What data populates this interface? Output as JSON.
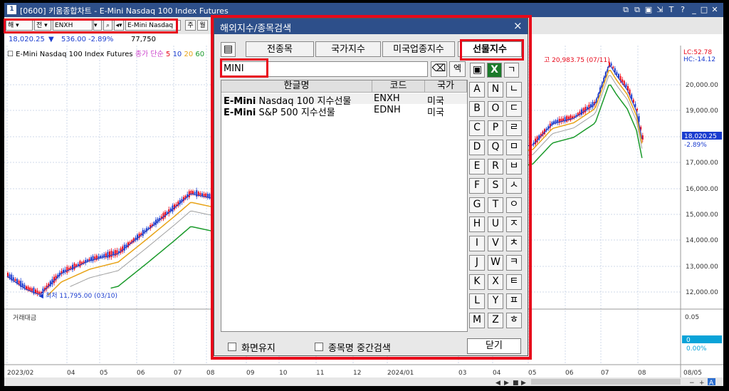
{
  "window": {
    "title": "[0600] 키움종합차트 - E-Mini Nasdaq 100 Index Futures",
    "app_icon": "1",
    "title_icons": [
      "restore-icon",
      "copy-icon",
      "window-icon",
      "pin-icon",
      "text-icon",
      "help-icon",
      "minimize-icon",
      "maximize-icon",
      "close-icon"
    ],
    "title_glyphs": [
      "⧉",
      "⧉",
      "▣",
      "⇲",
      "T",
      "?",
      "_",
      "□",
      "✕"
    ]
  },
  "toolbar": {
    "btn1": "해",
    "btn2": "전",
    "code": "ENXH",
    "search_glyph": "🔍",
    "name": "E-Mini Nasdaq",
    "btn_ju": "주",
    "btn_wol": "월"
  },
  "infobar": {
    "price": "18,020.25",
    "down_arrow": "▼",
    "change": "536.00",
    "pct": "-2.89%",
    "volume": "77,750"
  },
  "legend": {
    "name": "E-Mini Nasdaq 100 Index Futures",
    "ma_label": "종가 단순",
    "ma_values": [
      "5",
      "10",
      "20",
      "60"
    ]
  },
  "chart": {
    "high_label": "고 20,983.75 (07/11)",
    "low_label": "최저 11,795.00 (03/10)",
    "price_axis": [
      "20,000.00",
      "19,000.00",
      "18,000.00",
      "17,000.00",
      "16,000.00",
      "15,000.00",
      "14,000.00",
      "13,000.00",
      "12,000.00"
    ],
    "right_top_1": "LC:52.78",
    "right_top_2": "HC:-14.12",
    "current_price": "18,020.25",
    "current_pct": "-2.89%",
    "volume_pane_label": "거래대금",
    "volume_axis_top": "0.05",
    "volume_axis_mid": "0",
    "volume_value": "0",
    "volume_pct": "0.00%",
    "date_axis": [
      "2023/02",
      "04",
      "05",
      "06",
      "07",
      "08",
      "09",
      "10",
      "11",
      "12",
      "2024/01",
      "03",
      "04",
      "05",
      "06",
      "07",
      "08"
    ],
    "date_right": "08/05",
    "colors": {
      "up": "#e8081a",
      "down": "#1a3ccf",
      "ma5": "#e8a317",
      "ma20": "#a0a0a0",
      "ma60": "#1a9a2a",
      "ma10": "#2a40c0"
    }
  },
  "dialog": {
    "title": "해외지수/종목검색",
    "tabs": [
      "전종목",
      "국가지수",
      "미국업종지수",
      "선물지수"
    ],
    "search_value": "MINI",
    "eraser_glyph": "⌫",
    "history_label": "엑",
    "save_glyph": "💾",
    "excel_glyph": "X",
    "grid_glyph": "▤",
    "columns": [
      "한글명",
      "코드",
      "국가"
    ],
    "rows": [
      {
        "name_bold": "E-Mini",
        "name_rest": " Nasdaq 100 지수선물",
        "code": "ENXH",
        "country": "미국"
      },
      {
        "name_bold": "E-Mini",
        "name_rest": " S&P 500 지수선물",
        "code": "EDNH",
        "country": "미국"
      }
    ],
    "letters": [
      "A",
      "B",
      "C",
      "D",
      "E",
      "F",
      "G",
      "H",
      "I",
      "J",
      "K",
      "L",
      "M"
    ],
    "letters2": [
      "N",
      "O",
      "P",
      "Q",
      "R",
      "S",
      "T",
      "U",
      "V",
      "W",
      "X",
      "Y",
      "Z"
    ],
    "hangul": [
      "ㄱ",
      "ㄴ",
      "ㄷ",
      "ㄹ",
      "ㅁ",
      "ㅂ",
      "ㅅ",
      "ㅇ",
      "ㅈ",
      "ㅊ",
      "ㅋ",
      "ㅌ",
      "ㅍ",
      "ㅎ"
    ],
    "keep_screen": "화면유지",
    "middle_search": "종목명 중간검색",
    "close": "닫기"
  },
  "scrollbar": {
    "buttons": [
      "◀",
      "▶",
      "■",
      "▶",
      "|"
    ],
    "right_glyphs": [
      "−",
      "+",
      "A"
    ]
  }
}
